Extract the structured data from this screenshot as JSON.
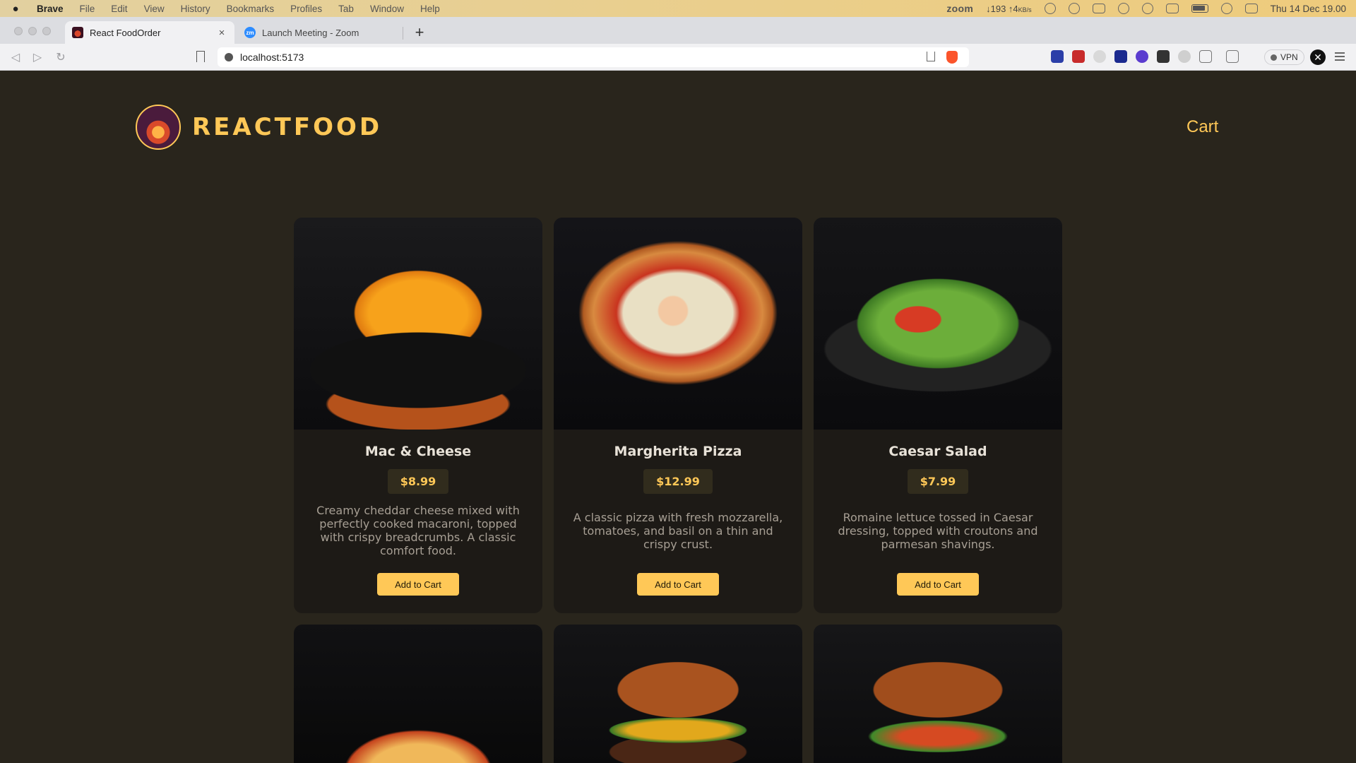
{
  "menubar": {
    "app": "Brave",
    "items": [
      "File",
      "Edit",
      "View",
      "History",
      "Bookmarks",
      "Profiles",
      "Tab",
      "Window",
      "Help"
    ],
    "zoom_label": "zoom",
    "net_rate": "↓193 ↑4",
    "net_unit": "KB/s",
    "datetime": "Thu 14 Dec  19.00"
  },
  "tabs": [
    {
      "title": "React FoodOrder",
      "active": true
    },
    {
      "title": "Launch Meeting - Zoom",
      "active": false,
      "favicon_text": "zm"
    }
  ],
  "toolbar": {
    "url": "localhost:5173",
    "vpn_label": "VPN"
  },
  "header": {
    "brand": "REACTFOOD",
    "cart_label": "Cart"
  },
  "meals": [
    {
      "name": "Mac & Cheese",
      "price": "$8.99",
      "description": "Creamy cheddar cheese mixed with perfectly cooked macaroni, topped with crispy breadcrumbs. A classic comfort food.",
      "button": "Add to Cart"
    },
    {
      "name": "Margherita Pizza",
      "price": "$12.99",
      "description": "A classic pizza with fresh mozzarella, tomatoes, and basil on a thin and crispy crust.",
      "button": "Add to Cart"
    },
    {
      "name": "Caesar Salad",
      "price": "$7.99",
      "description": "Romaine lettuce tossed in Caesar dressing, topped with croutons and parmesan shavings.",
      "button": "Add to Cart"
    }
  ],
  "colors": {
    "accent": "#ffc857",
    "page_bg": "#29251c",
    "card_bg": "#1d1a16",
    "price_bg": "#312c1d"
  }
}
